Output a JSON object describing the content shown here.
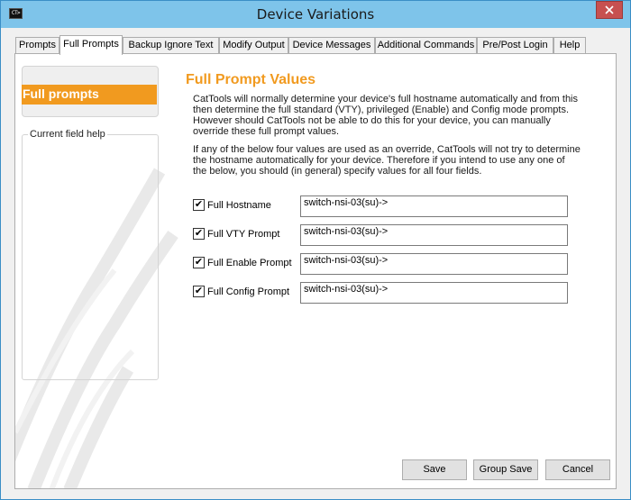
{
  "window": {
    "title": "Device Variations",
    "app_icon_text": "CT>"
  },
  "tabs": [
    {
      "label": "Prompts"
    },
    {
      "label": "Full Prompts",
      "active": true
    },
    {
      "label": "Backup Ignore Text"
    },
    {
      "label": "Modify Output"
    },
    {
      "label": "Device Messages"
    },
    {
      "label": "Additional Commands"
    },
    {
      "label": "Pre/Post Login"
    },
    {
      "label": "Help"
    }
  ],
  "sidebar": {
    "active_item": "Full prompts",
    "help_group_label": "Current field help"
  },
  "content": {
    "title": "Full Prompt Values",
    "paragraph1": "CatTools will normally determine your device's full hostname automatically and from this then determine the full standard (VTY), privileged (Enable) and Config mode prompts. However should CatTools not be able to do this for your device, you can manually override these full prompt values.",
    "paragraph2": "If any of the below four values are used as an override, CatTools will not try to determine the hostname automatically for your device. Therefore if you intend to use any one of the below, you should (in general) specify values for all four fields.",
    "fields": [
      {
        "label": "Full Hostname",
        "checked": true,
        "value": "switch-nsi-03(su)->"
      },
      {
        "label": "Full VTY Prompt",
        "checked": true,
        "value": "switch-nsi-03(su)->"
      },
      {
        "label": "Full Enable Prompt",
        "checked": true,
        "value": "switch-nsi-03(su)->"
      },
      {
        "label": "Full Config Prompt",
        "checked": true,
        "value": "switch-nsi-03(su)->"
      }
    ]
  },
  "buttons": {
    "save": "Save",
    "group_save": "Group Save",
    "cancel": "Cancel"
  },
  "colors": {
    "accent_orange": "#f19a1f",
    "titlebar": "#7ec4ea",
    "close_button": "#c75050"
  }
}
